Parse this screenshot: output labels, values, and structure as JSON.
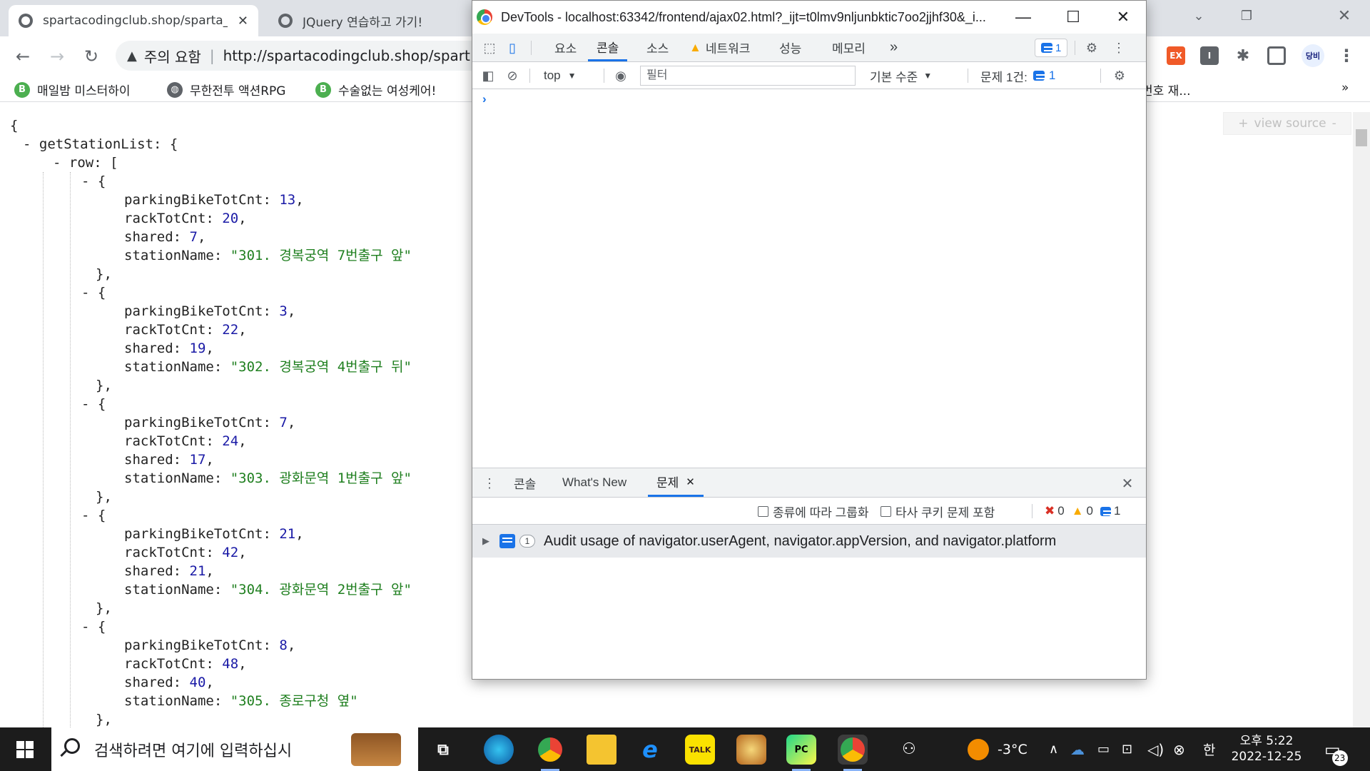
{
  "browser": {
    "tabs": [
      {
        "title": "spartacodingclub.shop/sparta_a",
        "close": "✕"
      },
      {
        "title": "JQuery 연습하고 가기!"
      }
    ],
    "address": {
      "security_label": "주의 요함",
      "url": "http://spartacodingclub.shop/spart"
    },
    "extension_labels": {
      "ex": "EX",
      "i": "I",
      "profile": "당비"
    },
    "bookmarks": [
      "매일밤 미스터하이",
      "무한전투 액션RPG",
      "수술없는 여성케어!",
      "번호 재..."
    ],
    "bookmarks_more": "»"
  },
  "json_viewer": {
    "view_source_label": "view source",
    "root_key": "getStationList",
    "list_key": "row",
    "stations": [
      {
        "parkingBikeTotCnt": 13,
        "rackTotCnt": 20,
        "shared": 7,
        "stationName": "301. 경복궁역 7번출구 앞"
      },
      {
        "parkingBikeTotCnt": 3,
        "rackTotCnt": 22,
        "shared": 19,
        "stationName": "302. 경복궁역 4번출구 뒤"
      },
      {
        "parkingBikeTotCnt": 7,
        "rackTotCnt": 24,
        "shared": 17,
        "stationName": "303. 광화문역 1번출구 앞"
      },
      {
        "parkingBikeTotCnt": 21,
        "rackTotCnt": 42,
        "shared": 21,
        "stationName": "304. 광화문역 2번출구 앞"
      },
      {
        "parkingBikeTotCnt": 8,
        "rackTotCnt": 48,
        "shared": 40,
        "stationName": "305. 종로구청 옆"
      }
    ]
  },
  "devtools": {
    "title": "DevTools - localhost:63342/frontend/ajax02.html?_ijt=t0lmv9nljunbktic7oo2jjhf30&_i...",
    "tabs": [
      "요소",
      "콘솔",
      "소스",
      "네트워크",
      "성능",
      "메모리"
    ],
    "active_tab": "콘솔",
    "more_tabs": "»",
    "message_count": "1",
    "context": "top",
    "filter_placeholder": "필터",
    "level": "기본 수준",
    "issues_label": "문제 1건:",
    "issues_count": "1",
    "prompt": "›",
    "drawer": {
      "tabs": [
        "콘솔",
        "What's New",
        "문제"
      ],
      "active_tab": "문제",
      "group_label": "종류에 따라 그룹화",
      "third_party_label": "타사 쿠키 문제 포함",
      "errors": "0",
      "warnings": "0",
      "infos": "1",
      "issue_count": "1",
      "issue_text": "Audit usage of navigator.userAgent, navigator.appVersion, and navigator.platform"
    }
  },
  "taskbar": {
    "search_placeholder": "검색하려면 여기에 입력하십시",
    "weather": "-3°C",
    "ime": "한",
    "time": "오후 5:22",
    "date": "2022-12-25",
    "notifications": "23"
  }
}
